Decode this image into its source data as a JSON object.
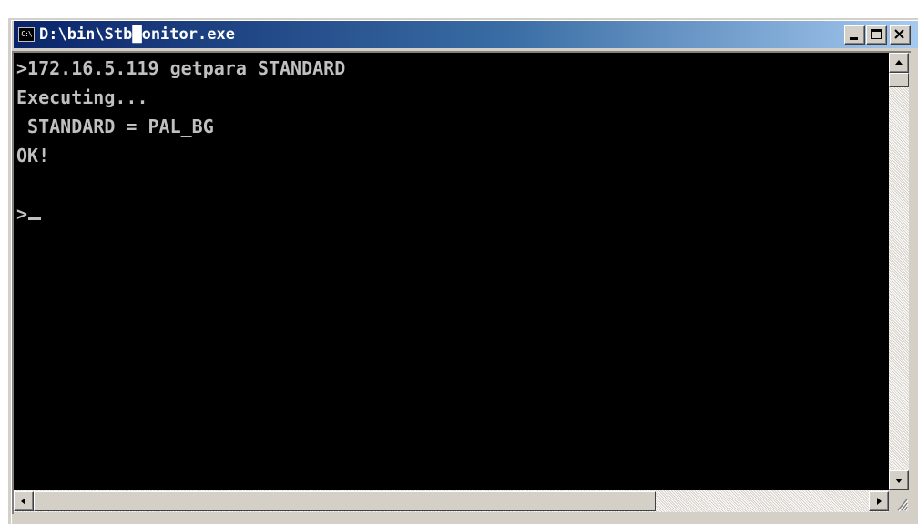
{
  "window": {
    "title": "D:\\bin\\Stb█onitor.exe",
    "icon_label": "C:\\",
    "icon": "console-icon"
  },
  "titlebar_buttons": {
    "minimize_icon": "minimize-icon",
    "maximize_icon": "maximize-icon",
    "close_icon": "close-icon"
  },
  "console": {
    "lines": [
      ">172.16.5.119 getpara STANDARD",
      "Executing...",
      " STANDARD = PAL_BG",
      "OK!",
      ">"
    ],
    "text_color": "#c0c0c0",
    "background_color": "#000000"
  },
  "scrollbars": {
    "vertical": {
      "up_icon": "arrow-up-icon",
      "down_icon": "arrow-down-icon"
    },
    "horizontal": {
      "left_icon": "arrow-left-icon",
      "right_icon": "arrow-right-icon"
    }
  },
  "colors": {
    "titlebar_start": "#0a246a",
    "titlebar_end": "#a6caf0",
    "chrome": "#d4d0c8"
  }
}
